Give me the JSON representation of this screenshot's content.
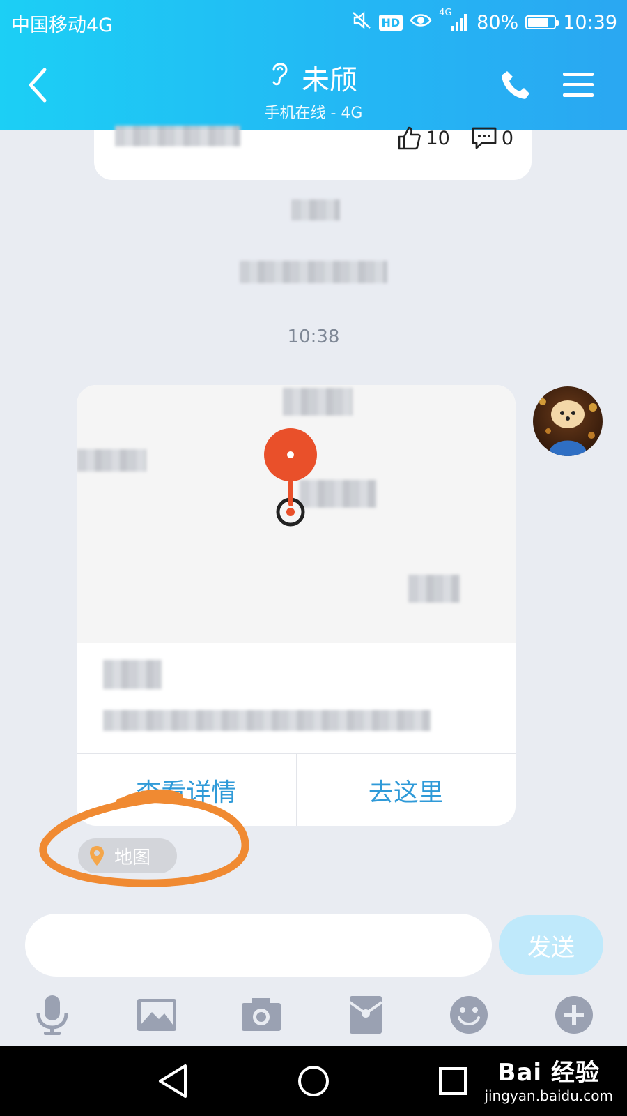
{
  "status_bar": {
    "carrier": "中国移动4G",
    "hd": "HD",
    "network": "4G",
    "battery": "80%",
    "battery_level": 0.8,
    "time": "10:39"
  },
  "header": {
    "contact_name": "未颀",
    "status": "手机在线 - 4G"
  },
  "shared_card": {
    "like_count": "10",
    "comment_count": "0"
  },
  "chat": {
    "timestamp": "10:38"
  },
  "location_card": {
    "view_details_label": "查看详情",
    "go_here_label": "去这里"
  },
  "map_chip": {
    "label": "地图"
  },
  "input": {
    "placeholder": "",
    "send_label": "发送"
  },
  "toolbar": {
    "items": [
      "microphone-icon",
      "image-icon",
      "camera-icon",
      "red-packet-icon",
      "emoji-icon",
      "plus-icon"
    ]
  },
  "watermark": {
    "brand": "Bai 经验",
    "url": "jingyan.baidu.com"
  },
  "colors": {
    "header_gradient_start": "#1ccff5",
    "header_gradient_end": "#2aa7f2",
    "accent_link": "#2f9ad8",
    "map_pin": "#e9502a",
    "annotation_stroke": "#f08a32",
    "send_button": "#bfe9fb"
  }
}
